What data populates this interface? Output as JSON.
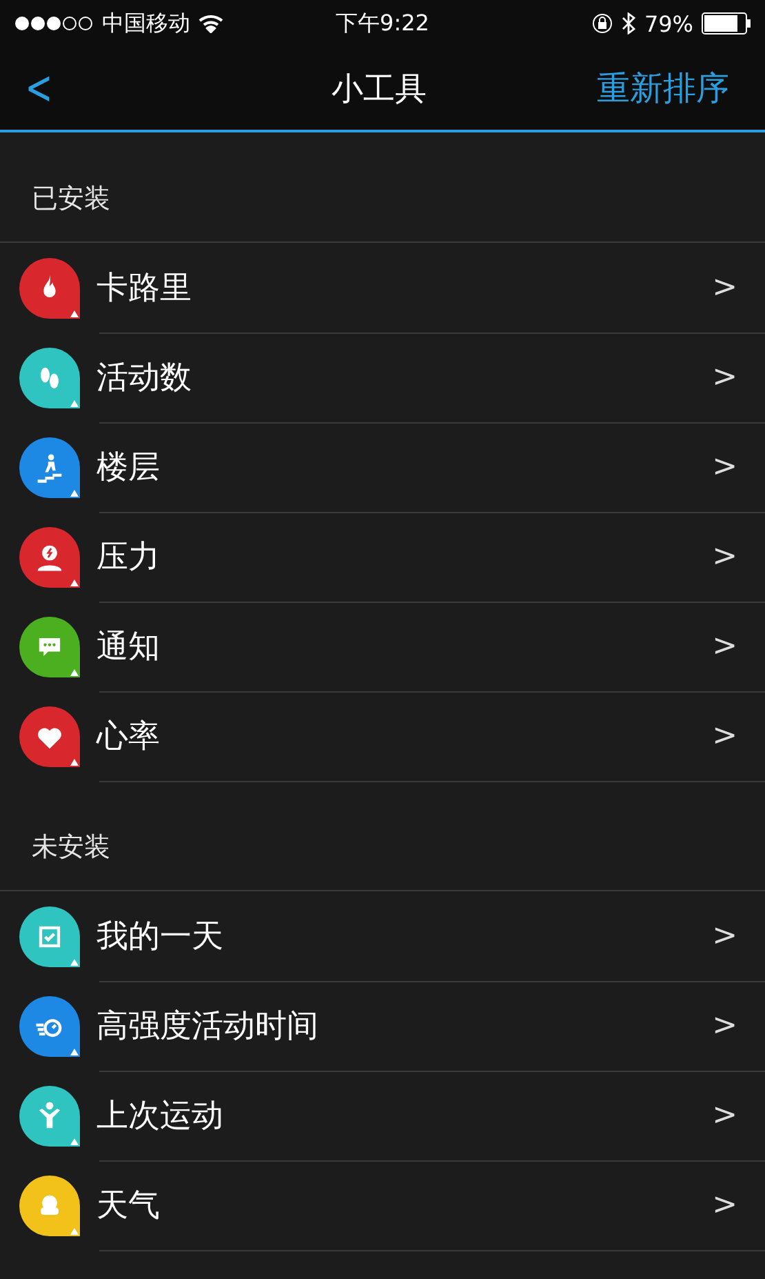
{
  "status_bar": {
    "carrier": "中国移动",
    "time": "下午9:22",
    "battery": "79%"
  },
  "nav": {
    "back": "<",
    "title": "小工具",
    "action": "重新排序"
  },
  "sections": [
    {
      "title": "已安装",
      "items": [
        {
          "label": "卡路里",
          "color": "#d9272e",
          "kind": "flame",
          "chevron": ">"
        },
        {
          "label": "活动数",
          "color": "#2fc4c0",
          "kind": "feet",
          "chevron": ">"
        },
        {
          "label": "楼层",
          "color": "#1e88e5",
          "kind": "stairs",
          "chevron": ">"
        },
        {
          "label": "压力",
          "color": "#d9272e",
          "kind": "stress",
          "chevron": ">"
        },
        {
          "label": "通知",
          "color": "#4caf1f",
          "kind": "chat",
          "chevron": ">"
        },
        {
          "label": "心率",
          "color": "#d9272e",
          "kind": "heart",
          "chevron": ">"
        }
      ]
    },
    {
      "title": "未安装",
      "items": [
        {
          "label": "我的一天",
          "color": "#2fc4c0",
          "kind": "calendar",
          "chevron": ">"
        },
        {
          "label": "高强度活动时间",
          "color": "#1e88e5",
          "kind": "timer",
          "chevron": ">"
        },
        {
          "label": "上次运动",
          "color": "#2fc4c0",
          "kind": "person",
          "chevron": ">"
        },
        {
          "label": "天气",
          "color": "#f2c21b",
          "kind": "weather",
          "chevron": ">"
        }
      ]
    }
  ]
}
